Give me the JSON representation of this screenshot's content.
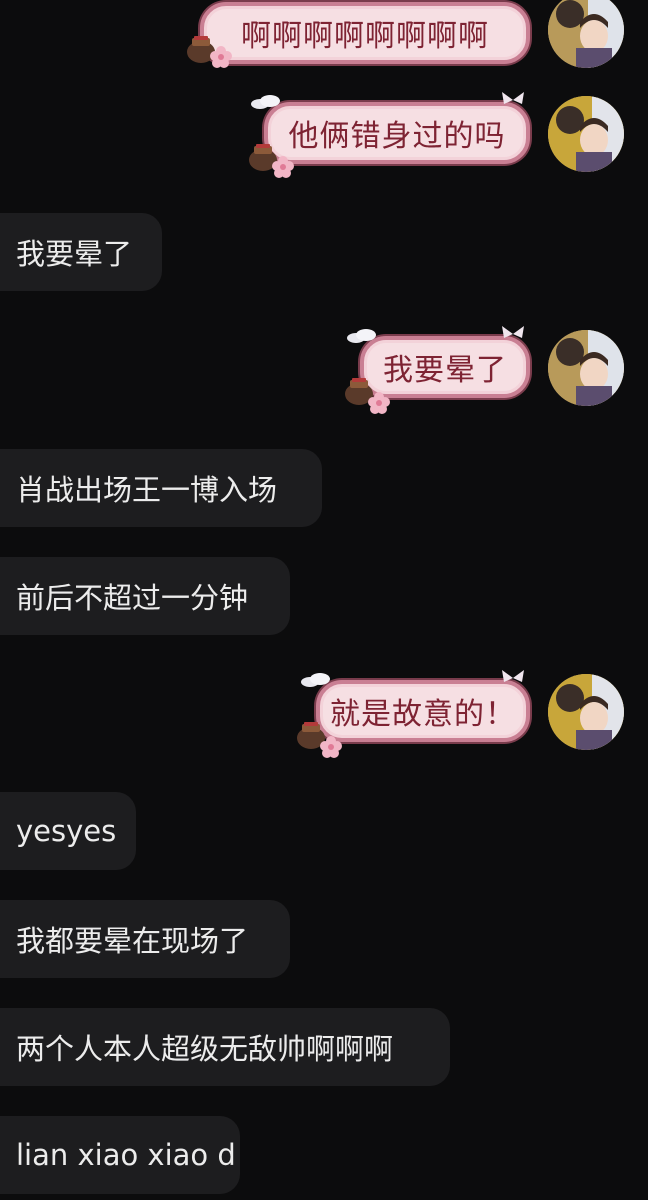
{
  "messages": [
    {
      "dir": "out",
      "text": "啊啊啊啊啊啊啊啊"
    },
    {
      "dir": "out",
      "text": "他俩错身过的吗"
    },
    {
      "dir": "in",
      "text": "我要晕了"
    },
    {
      "dir": "out",
      "text": "我要晕了"
    },
    {
      "dir": "in",
      "text": "肖战出场王一博入场"
    },
    {
      "dir": "in",
      "text": "前后不超过一分钟"
    },
    {
      "dir": "out",
      "text": "就是故意的！"
    },
    {
      "dir": "in",
      "text": "yesyes"
    },
    {
      "dir": "in",
      "text": "我都要晕在现场了"
    },
    {
      "dir": "in",
      "text": "两个人本人超级无敌帅啊啊啊"
    },
    {
      "dir": "in",
      "text": "lian xiao xiao d"
    }
  ],
  "colors": {
    "background": "#0c0c0d",
    "incoming_bubble": "#1d1d1f",
    "incoming_text": "#ececec",
    "outgoing_bubble": "#f6dfe3",
    "outgoing_border": "#c97f93",
    "outgoing_text": "#7e2333"
  },
  "icons": {
    "avatar": "user-avatar-icon",
    "jar": "jar-sticker-icon",
    "flower": "flower-sticker-icon",
    "cloud": "cloud-sticker-icon",
    "bow": "bow-sticker-icon"
  }
}
